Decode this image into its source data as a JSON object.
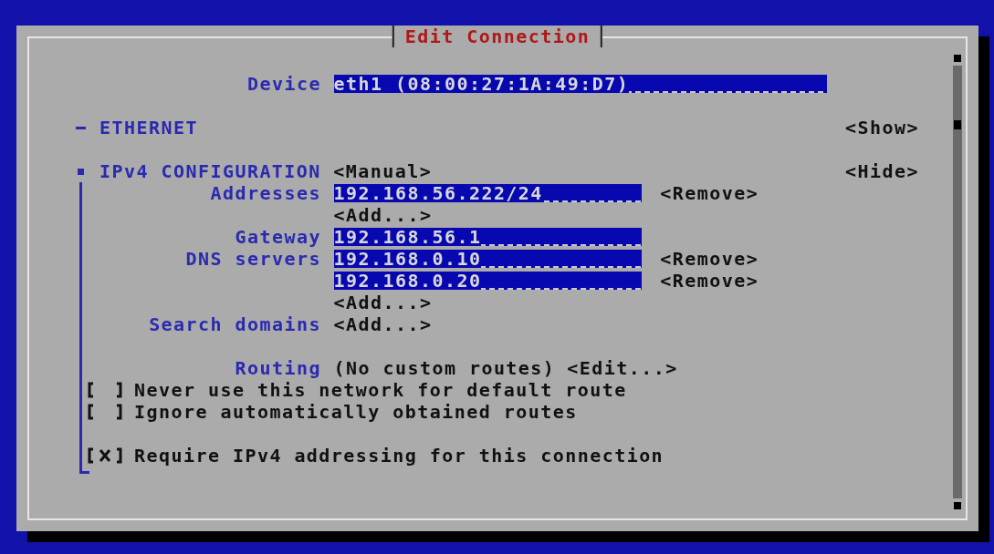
{
  "window": {
    "title": "Edit Connection"
  },
  "device": {
    "label": "Device",
    "value": "eth1 (08:00:27:1A:49:D7)"
  },
  "sections": [
    {
      "heading": "ETHERNET",
      "toggle": "<Show>",
      "expanded": false
    },
    {
      "heading": "IPv4 CONFIGURATION",
      "mode": "<Manual>",
      "toggle": "<Hide>",
      "expanded": true,
      "groups": [
        [
          {
            "kind": "field",
            "label": "Addresses",
            "value": "192.168.56.222/24",
            "action": "<Remove>"
          },
          {
            "kind": "button",
            "button": "<Add...>"
          },
          {
            "kind": "field",
            "label": "Gateway",
            "value": "192.168.56.1"
          },
          {
            "kind": "field",
            "label": "DNS servers",
            "value": "192.168.0.10",
            "action": "<Remove>"
          },
          {
            "kind": "field",
            "value": "192.168.0.20",
            "action": "<Remove>"
          },
          {
            "kind": "button",
            "button": "<Add...>"
          },
          {
            "kind": "button",
            "label": "Search domains",
            "button": "<Add...>"
          }
        ],
        [
          {
            "kind": "routing",
            "label": "Routing",
            "value": "(No custom routes)",
            "button": "<Edit...>"
          },
          {
            "kind": "checkbox",
            "label": "Never use this network for default route",
            "checked": false
          },
          {
            "kind": "checkbox",
            "label": "Ignore automatically obtained routes",
            "checked": false
          }
        ],
        [
          {
            "kind": "checkbox",
            "label": "Require IPv4 addressing for this connection",
            "checked": true
          }
        ]
      ]
    }
  ]
}
